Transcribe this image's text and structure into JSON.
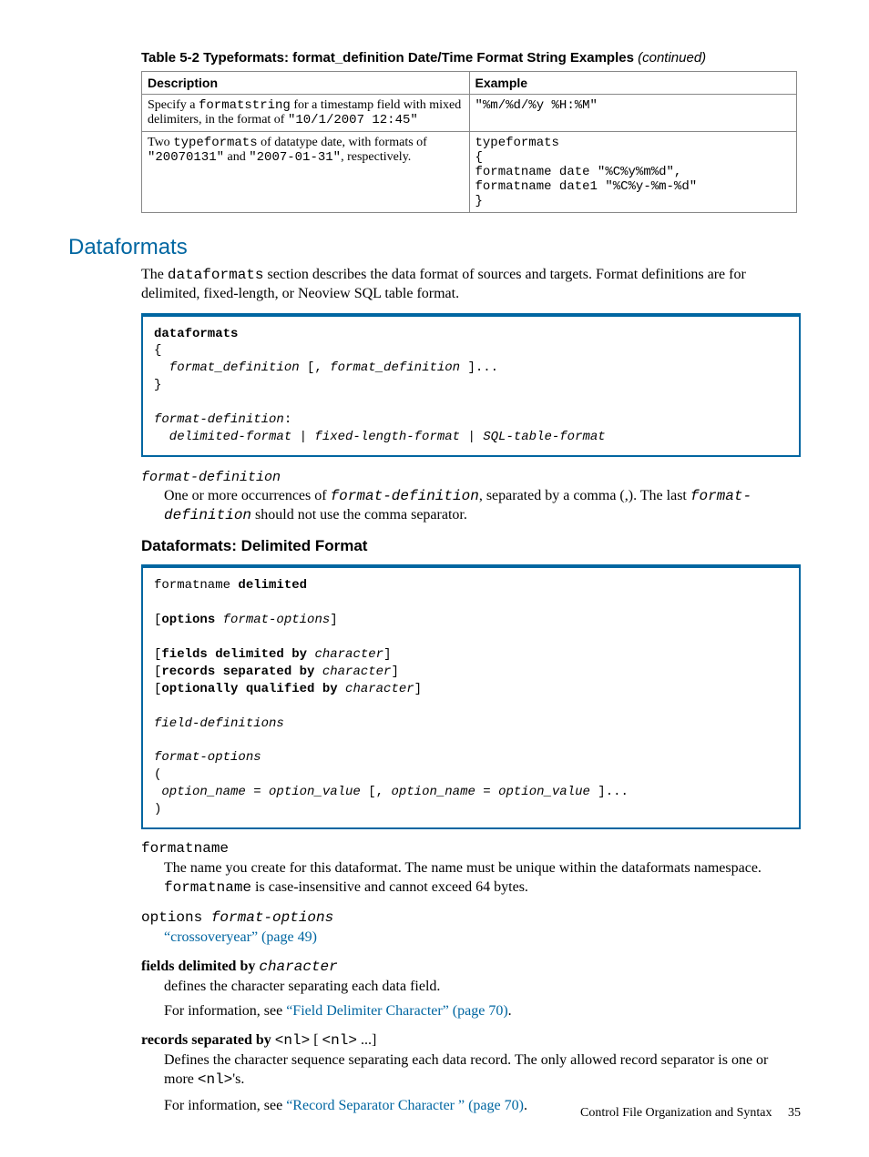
{
  "tableCaption": {
    "main": "Table 5-2 Typeformats: format_definition Date/Time Format String Examples",
    "cont": "(continued)"
  },
  "table": {
    "headers": [
      "Description",
      "Example"
    ],
    "rows": [
      {
        "desc": {
          "pre1": "Specify a ",
          "mono1": "formatstring",
          "mid1": " for a timestamp field with mixed delimiters, in the format of ",
          "mono2": "\"10/1/2007 12:45\""
        },
        "example": "\"%m/%d/%y %H:%M\""
      },
      {
        "desc": {
          "pre1": "Two ",
          "mono1": "typeformats",
          "mid1": " of datatype date, with formats of ",
          "mono2": "\"20070131\"",
          "mid2": " and ",
          "mono3": "\"2007-01-31\"",
          "post": ", respectively."
        },
        "example": "typeformats\n{\nformatname date \"%C%y%m%d\",\nformatname date1 \"%C%y-%m-%d\"\n}"
      }
    ]
  },
  "section": {
    "title": "Dataformats",
    "intro_a": "The ",
    "intro_mono": "dataformats",
    "intro_b": " section describes the data format of sources and targets. Format definitions are for delimited, fixed-length, or Neoview SQL table format."
  },
  "code1": {
    "l1_bold": "dataformats",
    "l2": "{",
    "l3_i": "  format_definition ",
    "l3_p": "[, ",
    "l3_i2": "format_definition",
    "l3_p2": " ]...",
    "l4": "}",
    "blank": "",
    "l5_i": "format-definition",
    "l5_p": ":",
    "l6_i": "  delimited-format | fixed-length-format | SQL-table-format"
  },
  "fd": {
    "term": "format-definition",
    "body_a": "One or more occurrences of ",
    "body_m1": "format-definition",
    "body_b": ", separated by a comma (,). The last ",
    "body_m2": "format-definition",
    "body_c": " should not use the comma separator."
  },
  "sub1": "Dataformats: Delimited Format",
  "code2": {
    "l1a": "formatname ",
    "l1b": "delimited",
    "blank": "",
    "l2a": "[",
    "l2b": "options",
    "l2c": " ",
    "l2d": "format-options",
    "l2e": "]",
    "l3a": "[",
    "l3b": "fields delimited by",
    "l3c": " ",
    "l3d": "character",
    "l3e": "]",
    "l4a": "[",
    "l4b": "records separated by",
    "l4c": " ",
    "l4d": "character",
    "l4e": "]",
    "l5a": "[",
    "l5b": "optionally qualified by",
    "l5c": " ",
    "l5d": "character",
    "l5e": "]",
    "l6": "field-definitions",
    "l7": "format-options",
    "l8": "(",
    "l9a": " option_name = option_value ",
    "l9b": "[, ",
    "l9c": "option_name = option_value",
    "l9d": " ]...",
    "l10": ")"
  },
  "defs": {
    "d1_term": "formatname",
    "d1_body_a": "The name you create for this dataformat. The name must be unique within the dataformats namespace. ",
    "d1_body_m": "formatname",
    "d1_body_b": " is case-insensitive and cannot exceed 64 bytes.",
    "d2_term_a": "options ",
    "d2_term_i": "format-options",
    "d2_link": "“crossoveryear” (page 49)",
    "d3_term_b": "fields delimited by ",
    "d3_term_i": "character",
    "d3_body1": "defines the character separating each data field.",
    "d3_body2a": "For information, see ",
    "d3_link": "“Field Delimiter Character” (page 70)",
    "d3_body2b": ".",
    "d4_term_b": "records separated by ",
    "d4_term_m1": "<nl>",
    "d4_term_p": " [ ",
    "d4_term_m2": "<nl>",
    "d4_term_p2": " ...]",
    "d4_body1a": "Defines the character sequence separating each data record. The only allowed record separator is one or more ",
    "d4_body1m": "<nl>",
    "d4_body1b": "'s.",
    "d4_body2a": "For information, see ",
    "d4_link": "“Record Separator Character ” (page 70)",
    "d4_body2b": "."
  },
  "footer": {
    "text": "Control File Organization and Syntax",
    "page": "35"
  }
}
